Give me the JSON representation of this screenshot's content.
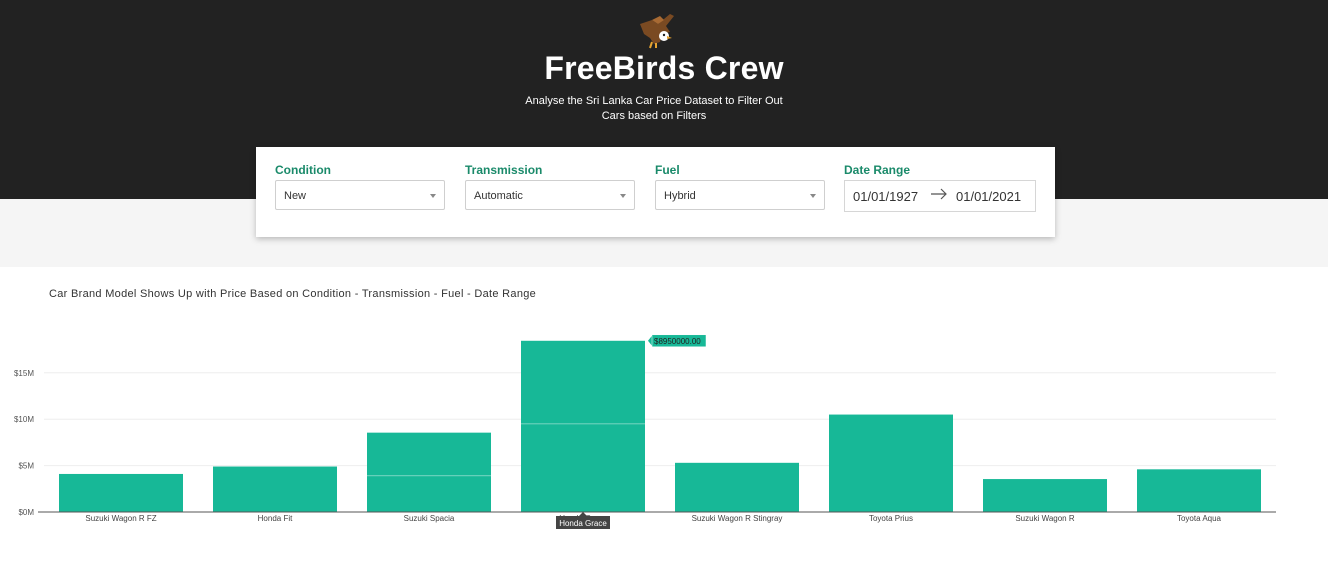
{
  "header": {
    "title": "FreeBirds Crew",
    "subtitle": "Analyse the Sri Lanka Car Price Dataset to Filter Out Cars based on Filters",
    "logo_icon": "eagle-icon"
  },
  "filters": {
    "condition": {
      "label": "Condition",
      "value": "New"
    },
    "transmission": {
      "label": "Transmission",
      "value": "Automatic"
    },
    "fuel": {
      "label": "Fuel",
      "value": "Hybrid"
    },
    "date_range": {
      "label": "Date Range",
      "start": "01/01/1927",
      "end": "01/01/2021"
    }
  },
  "colors": {
    "accent": "#17b897",
    "header_bg": "#222222",
    "label_green": "#1a8a6a"
  },
  "chart_title": "Car Brand Model Shows Up with Price Based on Condition - Transmission - Fuel - Date Range",
  "chart_data": {
    "type": "bar",
    "title": "Car Brand Model Shows Up with Price Based on Condition - Transmission - Fuel - Date Range",
    "categories": [
      "Suzuki Wagon R FZ",
      "Honda Fit",
      "Suzuki Spacia",
      "Honda Grace",
      "Suzuki Wagon R Stingray",
      "Toyota Prius",
      "Suzuki Wagon R",
      "Toyota Aqua"
    ],
    "stacks": [
      [
        4100000
      ],
      [
        4900000
      ],
      [
        3900000,
        4650000
      ],
      [
        9500000,
        8950000
      ],
      [
        5300000
      ],
      [
        10500000
      ],
      [
        3550000
      ],
      [
        4600000
      ]
    ],
    "yticks": [
      "$0M",
      "$5M",
      "$10M",
      "$15M"
    ],
    "ytick_values": [
      0,
      5000000,
      10000000,
      15000000
    ],
    "ylim": [
      0,
      19000000
    ],
    "grid": true,
    "hover": {
      "category_index": 3,
      "value_label": "$8950000.00",
      "category_label": "Honda Grace"
    }
  }
}
